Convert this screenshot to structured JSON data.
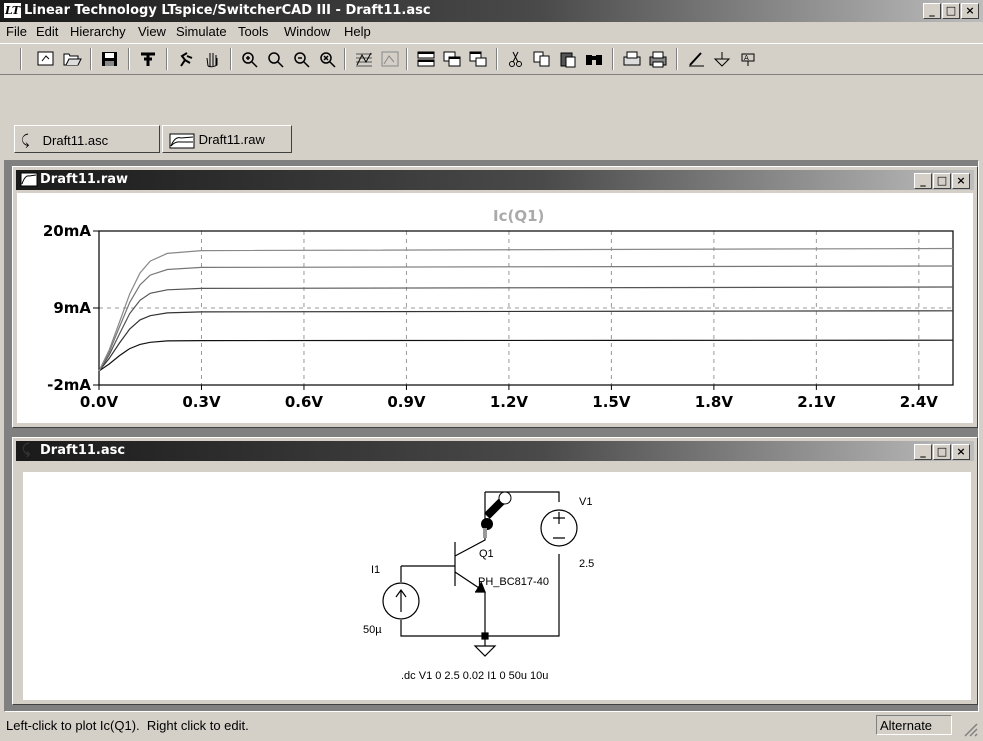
{
  "app": {
    "title": "Linear Technology LTspice/SwitcherCAD III - Draft11.asc",
    "logo": "LT"
  },
  "menu": [
    {
      "label": "File"
    },
    {
      "label": "Edit"
    },
    {
      "label": "Hierarchy"
    },
    {
      "label": "View"
    },
    {
      "label": "Simulate"
    },
    {
      "label": "Tools"
    },
    {
      "label": "Window"
    },
    {
      "label": "Help"
    }
  ],
  "toolbar": {
    "icons": [
      "new-schematic",
      "open",
      "save",
      "control-panel",
      "run",
      "halt",
      "zoom-in",
      "zoom-pan",
      "zoom-out",
      "zoom-fit",
      "autorange-y",
      "mark-unref",
      "tile-horizontal",
      "cascade",
      "tile-vertical",
      "cut",
      "copy",
      "paste",
      "find",
      "print-setup",
      "print",
      "draw-wire",
      "ground",
      "label-net"
    ]
  },
  "tabs": [
    {
      "label": "Draft11.asc",
      "icon": "schematic-icon"
    },
    {
      "label": "Draft11.raw",
      "icon": "waveform-icon"
    }
  ],
  "waveform": {
    "title": "Draft11.raw",
    "trace_label": "Ic(Q1)"
  },
  "schematic": {
    "title": "Draft11.asc",
    "labels": {
      "v1": "V1",
      "v1_value": "2.5",
      "q1": "Q1",
      "q1_model": "PH_BC817-40",
      "i1": "I1",
      "i1_value": "50µ",
      "directive": ".dc V1 0 2.5 0.02 I1 0 50u 10u"
    }
  },
  "status": {
    "message": "Left-click to plot Ic(Q1).  Right click to edit.",
    "mode": "Alternate"
  },
  "chart_data": {
    "type": "line",
    "title": "Ic(Q1)",
    "xlabel": "",
    "ylabel": "",
    "x_ticks": [
      "0.0V",
      "0.3V",
      "0.6V",
      "0.9V",
      "1.2V",
      "1.5V",
      "1.8V",
      "2.1V",
      "2.4V"
    ],
    "y_ticks": [
      "20mA",
      "9mA",
      "-2mA"
    ],
    "xlim": [
      0,
      2.5
    ],
    "ylim": [
      -2,
      20
    ],
    "grid": true,
    "series": [
      {
        "values_note": "",
        "x": [
          0,
          0.03,
          0.06,
          0.09,
          0.12,
          0.15,
          0.2,
          0.3,
          2.5
        ],
        "y": [
          0,
          1.0,
          2.2,
          3.2,
          3.8,
          4.1,
          4.3,
          4.35,
          4.4
        ]
      },
      {
        "values_note": "",
        "x": [
          0,
          0.03,
          0.06,
          0.09,
          0.12,
          0.15,
          0.2,
          0.3,
          2.5
        ],
        "y": [
          0,
          1.8,
          4.0,
          6.0,
          7.3,
          7.9,
          8.3,
          8.45,
          8.6
        ]
      },
      {
        "values_note": "",
        "x": [
          0,
          0.03,
          0.06,
          0.09,
          0.12,
          0.15,
          0.2,
          0.3,
          2.5
        ],
        "y": [
          0,
          2.3,
          5.3,
          8.2,
          10.1,
          11.1,
          11.6,
          11.8,
          12.0
        ]
      },
      {
        "values_note": "",
        "x": [
          0,
          0.03,
          0.06,
          0.09,
          0.12,
          0.15,
          0.2,
          0.3,
          2.5
        ],
        "y": [
          0,
          2.7,
          6.3,
          9.8,
          12.3,
          13.7,
          14.5,
          14.8,
          15.0
        ]
      },
      {
        "values_note": "",
        "x": [
          0,
          0.03,
          0.06,
          0.09,
          0.12,
          0.15,
          0.2,
          0.3,
          2.5
        ],
        "y": [
          0,
          3.0,
          7.0,
          11.0,
          14.0,
          15.7,
          16.8,
          17.2,
          17.5
        ]
      }
    ]
  }
}
